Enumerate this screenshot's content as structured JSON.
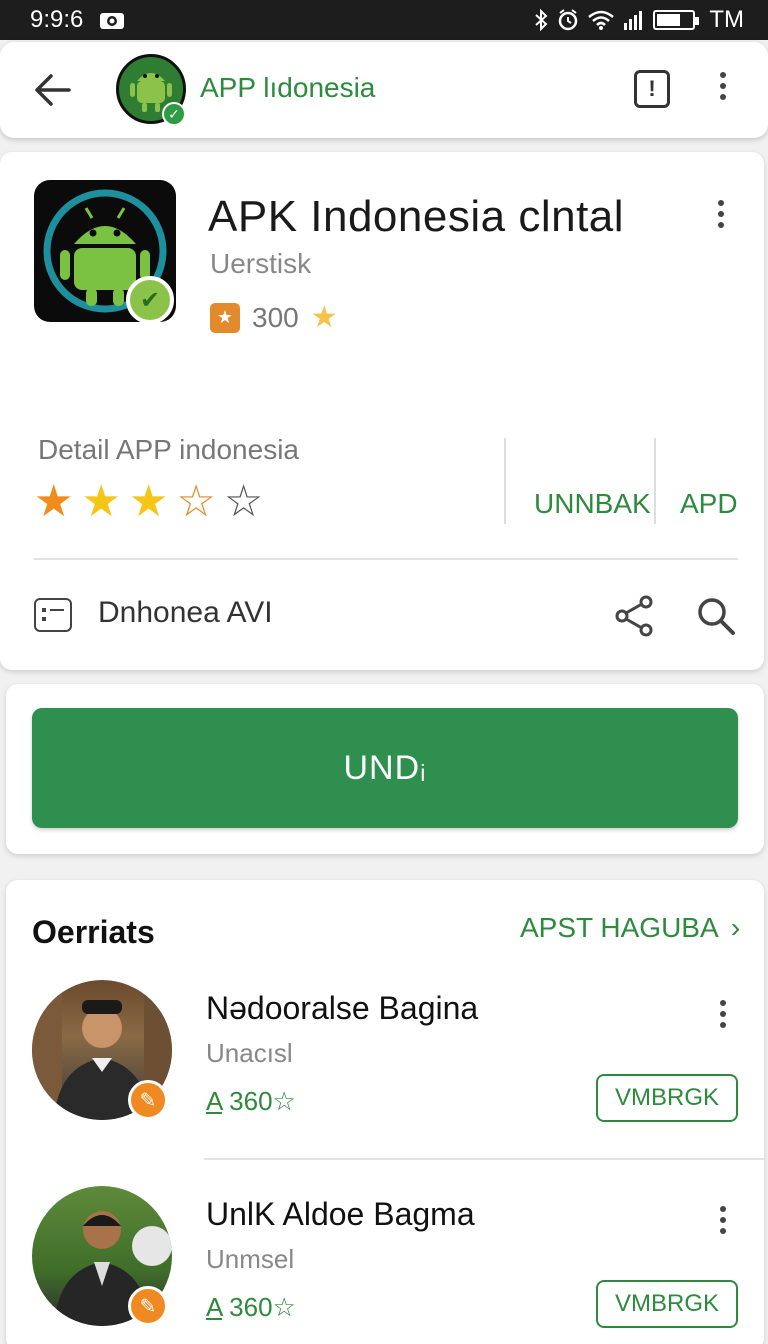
{
  "status_bar": {
    "time": "9:9:6",
    "carrier": "TM"
  },
  "header": {
    "title": "APP lıdonesia"
  },
  "app": {
    "name": "APK Indonesia clntal",
    "developer": "Uerstisk",
    "rating_count": "300",
    "detail_label": "Detail APP indonesia",
    "stars_filled": 3,
    "stars_total": 5,
    "action_1": "UNNBAK",
    "action_2": "APD",
    "info_row": "Dnhonea AVI"
  },
  "install": {
    "label": "UNDᵢ"
  },
  "section": {
    "title": "Oerriats",
    "more_label": "APST HAGUBA"
  },
  "people": [
    {
      "name": "Nədooralse Bagina",
      "sub": "Unacısl",
      "score": "360",
      "button": "VMBRGK"
    },
    {
      "name": "UnlK Aldoe Bagma",
      "sub": "Unmsel",
      "score": "360",
      "button": "VMBRGK"
    }
  ],
  "colors": {
    "accent": "#2e8b3e",
    "install_bg": "#2f8f4e",
    "star": "#f5b51c",
    "badge_orange": "#ef8a22"
  }
}
